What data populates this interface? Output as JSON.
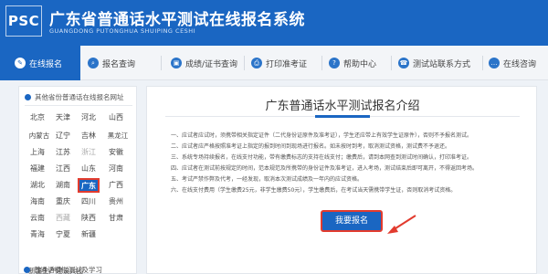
{
  "header": {
    "logo": "PSC",
    "title": "广东省普通话水平测试在线报名系统",
    "subtitle": "GUANGDONG PUTONGHUA SHUIPING CESHI"
  },
  "nav": [
    {
      "label": "在线报名",
      "icon": "edit-icon",
      "active": true
    },
    {
      "label": "报名查询",
      "icon": "search-icon"
    },
    {
      "label": "成绩/证书查询",
      "icon": "certificate-icon"
    },
    {
      "label": "打印准考证",
      "icon": "printer-icon"
    },
    {
      "label": "帮助中心",
      "icon": "help-icon"
    },
    {
      "label": "测试站联系方式",
      "icon": "contact-icon"
    },
    {
      "label": "在线咨询",
      "icon": "chat-icon"
    }
  ],
  "sidebar": {
    "heading_other": "其他省份普通话在线报名网址",
    "provinces": [
      "北京",
      "天津",
      "河北",
      "山西",
      "内蒙古",
      "辽宁",
      "吉林",
      "黑龙江",
      "上海",
      "江苏",
      "浙江",
      "安徽",
      "福建",
      "江西",
      "山东",
      "河南",
      "湖北",
      "湖南",
      "广东",
      "广西",
      "海南",
      "重庆",
      "四川",
      "贵州",
      "云南",
      "西藏",
      "陕西",
      "甘肃",
      "青海",
      "宁夏",
      "新疆"
    ],
    "selected": "广东",
    "corps": "新疆生产建设兵团",
    "heading_mock": "普通话模拟测试及学习"
  },
  "main": {
    "title": "广东普通话水平测试报名介绍",
    "notices": [
      "一、应试者应试时，须携带相关指定证件（二代身份证原件及准考证），学生还应带上有效学生证原件），否则不予报名测试。",
      "二、应试者应严格按照准考证上指定的报到时间到现场进行报名。如未按时到考，取消测试资格，测试费不予退还。",
      "三、系统专场持续报名，在线支付功能，带有缴费标志的支持在线支付；缴费后，请到本网查到测试时间确认，打印准考证。",
      "四、应试者在测试前按规定的时间，范本规范及所携带的身份证件及准考证，进入考场，测试结束后即可离开，不得返回考场。",
      "五、考试严禁作弊及代考，一经发现，取消本次测试成绩及一年内的应试资格。",
      "六、在线支付费用（学生缴费25元，非学生缴费50元），学生缴费后，在考试当天需携带学生证，否则取消考试资格。"
    ],
    "signup_button": "我要报名"
  },
  "colors": {
    "primary": "#1a66c2",
    "highlight": "#e23b2e"
  }
}
